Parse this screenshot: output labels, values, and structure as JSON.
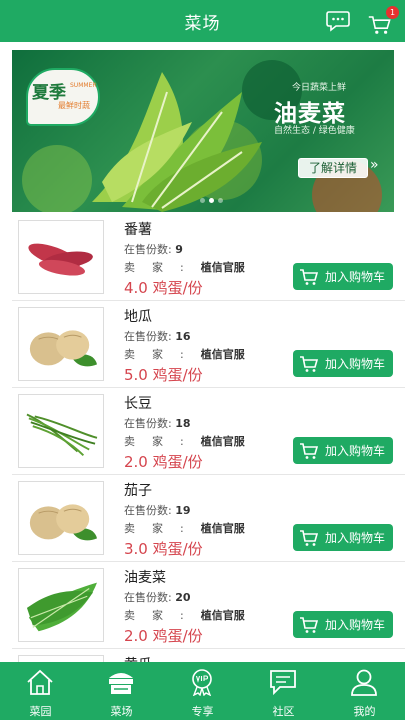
{
  "header": {
    "title": "菜场",
    "cart_badge": "1",
    "icons": {
      "chat": "chat-bubble-icon",
      "cart": "shopping-cart-icon"
    }
  },
  "banner": {
    "badge_title": "夏季",
    "badge_en": "SUMMER",
    "badge_sub": "最鲜时蔬",
    "kicker": "今日蔬菜上鲜",
    "headline": "油麦菜",
    "tagline": "自然生态 / 绿色健康",
    "detail_button": "了解详情",
    "detail_arrows": "»"
  },
  "labels": {
    "stock": "在售份数:",
    "seller": "卖家:",
    "add_to_cart": "加入购物车"
  },
  "products": [
    {
      "name": "番薯",
      "stock": "9",
      "seller": "植信官服",
      "price": "4.0 鸡蛋/份",
      "image": "sweet-potato"
    },
    {
      "name": "地瓜",
      "stock": "16",
      "seller": "植信官服",
      "price": "5.0 鸡蛋/份",
      "image": "jicama"
    },
    {
      "name": "长豆",
      "stock": "18",
      "seller": "植信官服",
      "price": "2.0 鸡蛋/份",
      "image": "long-bean"
    },
    {
      "name": "茄子",
      "stock": "19",
      "seller": "植信官服",
      "price": "3.0 鸡蛋/份",
      "image": "jicama"
    },
    {
      "name": "油麦菜",
      "stock": "20",
      "seller": "植信官服",
      "price": "2.0 鸡蛋/份",
      "image": "lettuce"
    },
    {
      "name": "黄瓜",
      "stock": "",
      "seller": "",
      "price": "",
      "image": "cucumber"
    }
  ],
  "nav": [
    {
      "label": "菜园",
      "icon": "house-icon"
    },
    {
      "label": "菜场",
      "icon": "market-stall-icon",
      "active": true
    },
    {
      "label": "专享",
      "icon": "vip-icon"
    },
    {
      "label": "社区",
      "icon": "community-chat-icon"
    },
    {
      "label": "我的",
      "icon": "user-icon"
    }
  ],
  "colors": {
    "primary": "#1faa63",
    "price": "#d5454e",
    "badge": "#e8312f"
  }
}
